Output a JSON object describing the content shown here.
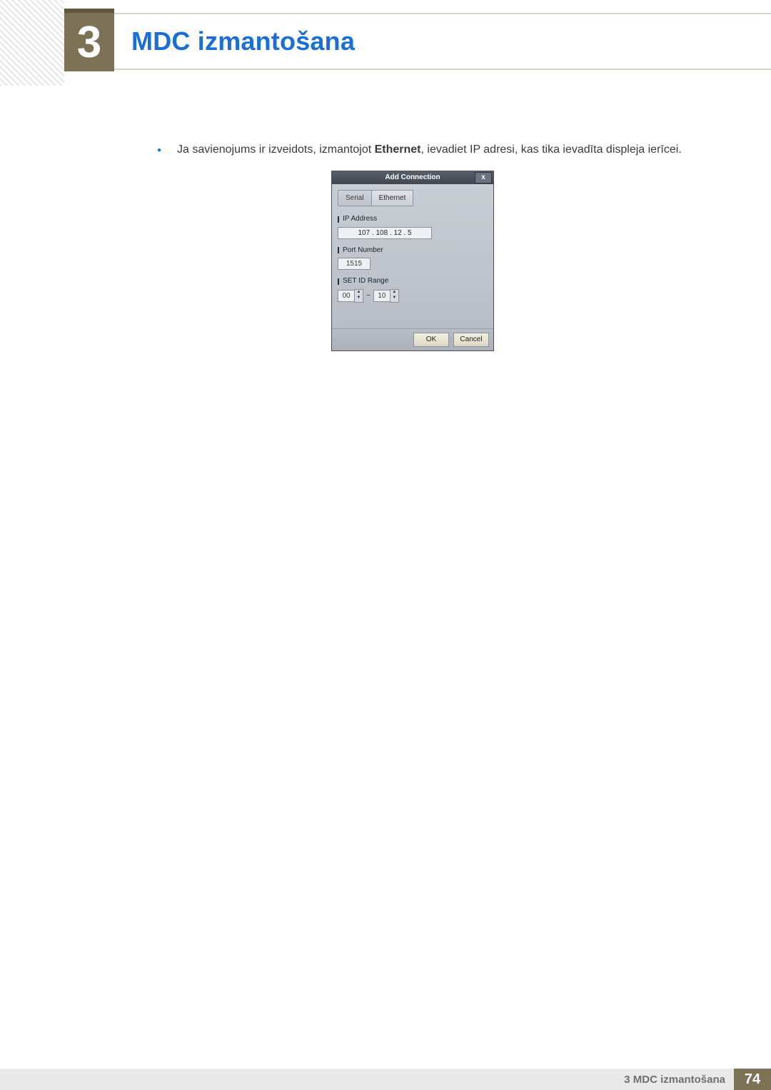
{
  "chapter": {
    "number": "3",
    "title": "MDC izmantošana"
  },
  "body": {
    "bullet_pre": "Ja savienojums ir izveidots, izmantojot ",
    "bullet_bold": "Ethernet",
    "bullet_post": ", ievadiet IP adresi, kas tika ievadīta displeja ierīcei."
  },
  "dialog": {
    "title": "Add Connection",
    "close": "x",
    "tabs": {
      "serial": "Serial",
      "ethernet": "Ethernet"
    },
    "labels": {
      "ip": "IP Address",
      "port": "Port Number",
      "range": "SET ID Range"
    },
    "ip_value": "107 . 108 .  12  .   5",
    "port_value": "1515",
    "range_from": "00",
    "range_to": "10",
    "range_sep": "~",
    "ok": "OK",
    "cancel": "Cancel"
  },
  "footer": {
    "text": "3 MDC izmantošana",
    "page": "74"
  }
}
